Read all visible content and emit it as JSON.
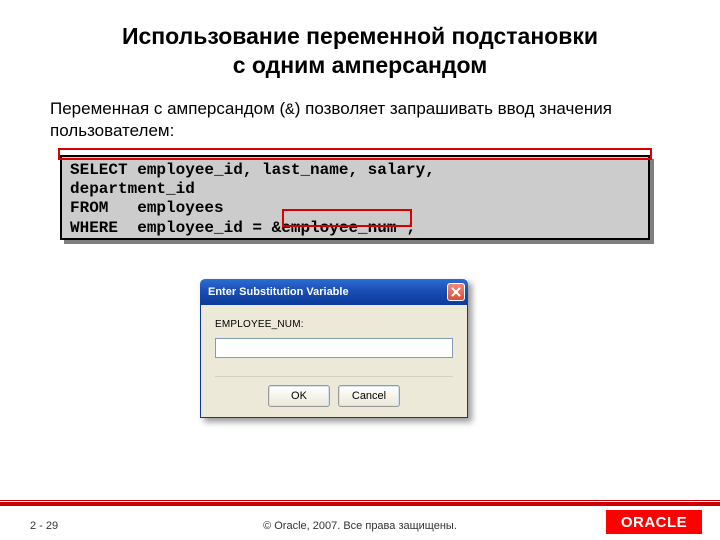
{
  "title": {
    "line1": "Использование переменной подстановки",
    "line2": "с одним амперсандом"
  },
  "intro": {
    "part1": "Переменная с амперсандом (",
    "ampersand": "&",
    "part2": ") позволяет запрашивать ввод значения пользователем:"
  },
  "code": {
    "sql": "SELECT employee_id, last_name, salary,\ndepartment_id\nFROM   employees\nWHERE  employee_id = &employee_num ;"
  },
  "dialog": {
    "title": "Enter Substitution Variable",
    "label": "EMPLOYEE_NUM:",
    "ok": "OK",
    "cancel": "Cancel"
  },
  "footer": {
    "page": "2 - 29",
    "copyright": "© Oracle, 2007. Все права защищены.",
    "logo": "ORACLE"
  }
}
